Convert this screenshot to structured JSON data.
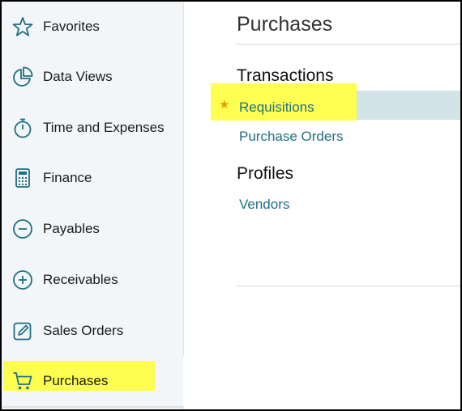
{
  "sidebar": {
    "items": [
      {
        "label": "Favorites",
        "icon": "star-outline-icon"
      },
      {
        "label": "Data Views",
        "icon": "pie-chart-icon"
      },
      {
        "label": "Time and Expenses",
        "icon": "stopwatch-icon"
      },
      {
        "label": "Finance",
        "icon": "calculator-icon"
      },
      {
        "label": "Payables",
        "icon": "minus-circle-icon"
      },
      {
        "label": "Receivables",
        "icon": "plus-circle-icon"
      },
      {
        "label": "Sales Orders",
        "icon": "edit-icon"
      },
      {
        "label": "Purchases",
        "icon": "cart-icon"
      }
    ],
    "active": "Purchases"
  },
  "main": {
    "title": "Purchases",
    "sections": [
      {
        "title": "Transactions",
        "links": [
          "Requisitions",
          "Purchase Orders"
        ]
      },
      {
        "title": "Profiles",
        "links": [
          "Vendors"
        ]
      }
    ],
    "favorite_link": "Requisitions"
  },
  "colors": {
    "accent": "#1e6f83",
    "highlight": "#ffff33",
    "star": "#e8a100"
  }
}
